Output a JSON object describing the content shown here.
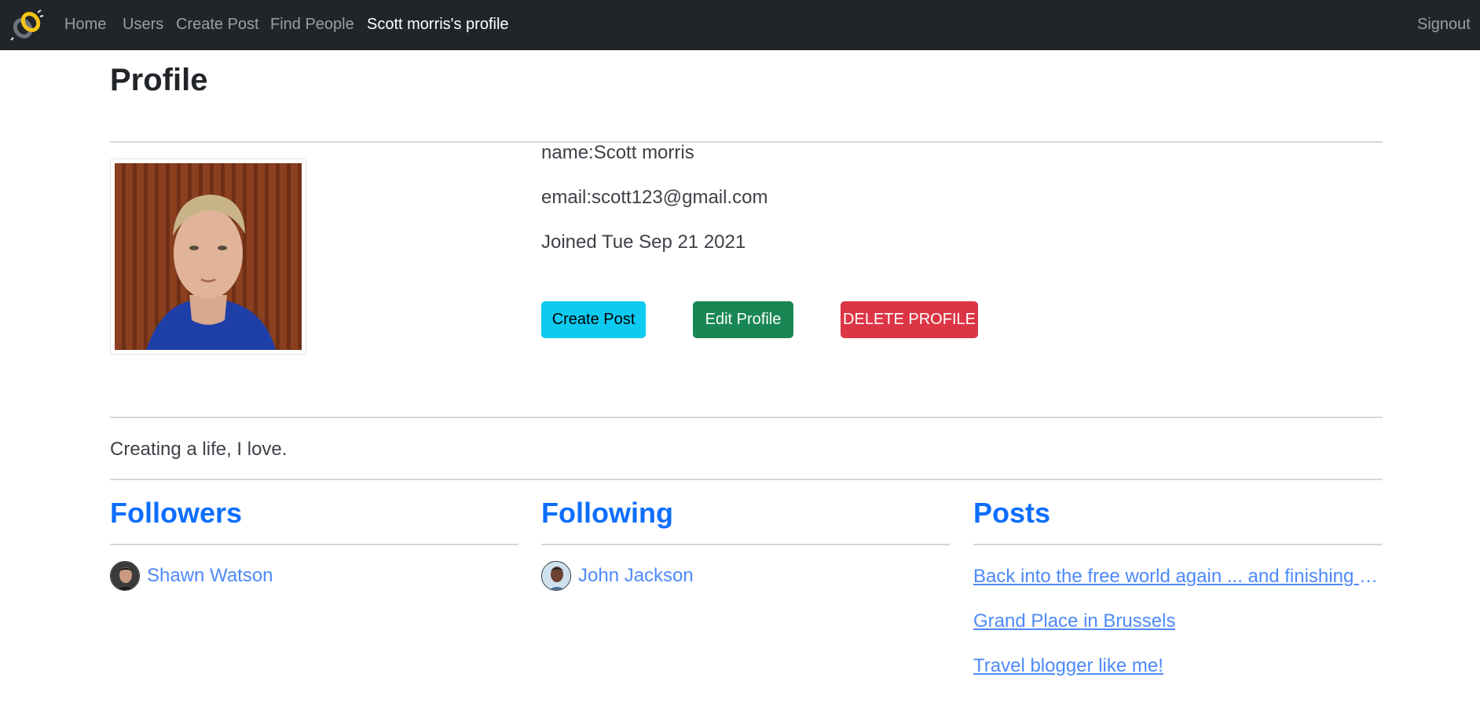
{
  "nav": {
    "brand_icon": "link-chain-logo-icon",
    "items": [
      {
        "label": "Home"
      },
      {
        "label": "Users"
      },
      {
        "label": "Create Post"
      },
      {
        "label": "Find People"
      },
      {
        "label": "Scott morris's profile"
      }
    ],
    "signout": "Signout"
  },
  "page": {
    "title": "Profile"
  },
  "profile": {
    "name": "name:Scott morris",
    "email": "email:scott123@gmail.com",
    "joined": "Joined Tue Sep 21 2021",
    "about": "Creating a life, I love."
  },
  "actions": {
    "create_post": "Create Post",
    "edit_profile": "Edit Profile",
    "delete_profile": "DELETE PROFILE"
  },
  "sections": {
    "followers": {
      "title": "Followers",
      "people": [
        {
          "name": "Shawn Watson"
        }
      ]
    },
    "following": {
      "title": "Following",
      "people": [
        {
          "name": "John Jackson"
        }
      ]
    },
    "posts": {
      "title": "Posts",
      "items": [
        {
          "title": "Back into the free world again ... and finishing o..."
        },
        {
          "title": "Grand Place in Brussels"
        },
        {
          "title": "Travel blogger like me!"
        }
      ]
    }
  },
  "colors": {
    "navbar": "#212529",
    "link": "#0d6efd",
    "info": "#0dcaf0",
    "success": "#198754",
    "danger": "#dc3545"
  }
}
